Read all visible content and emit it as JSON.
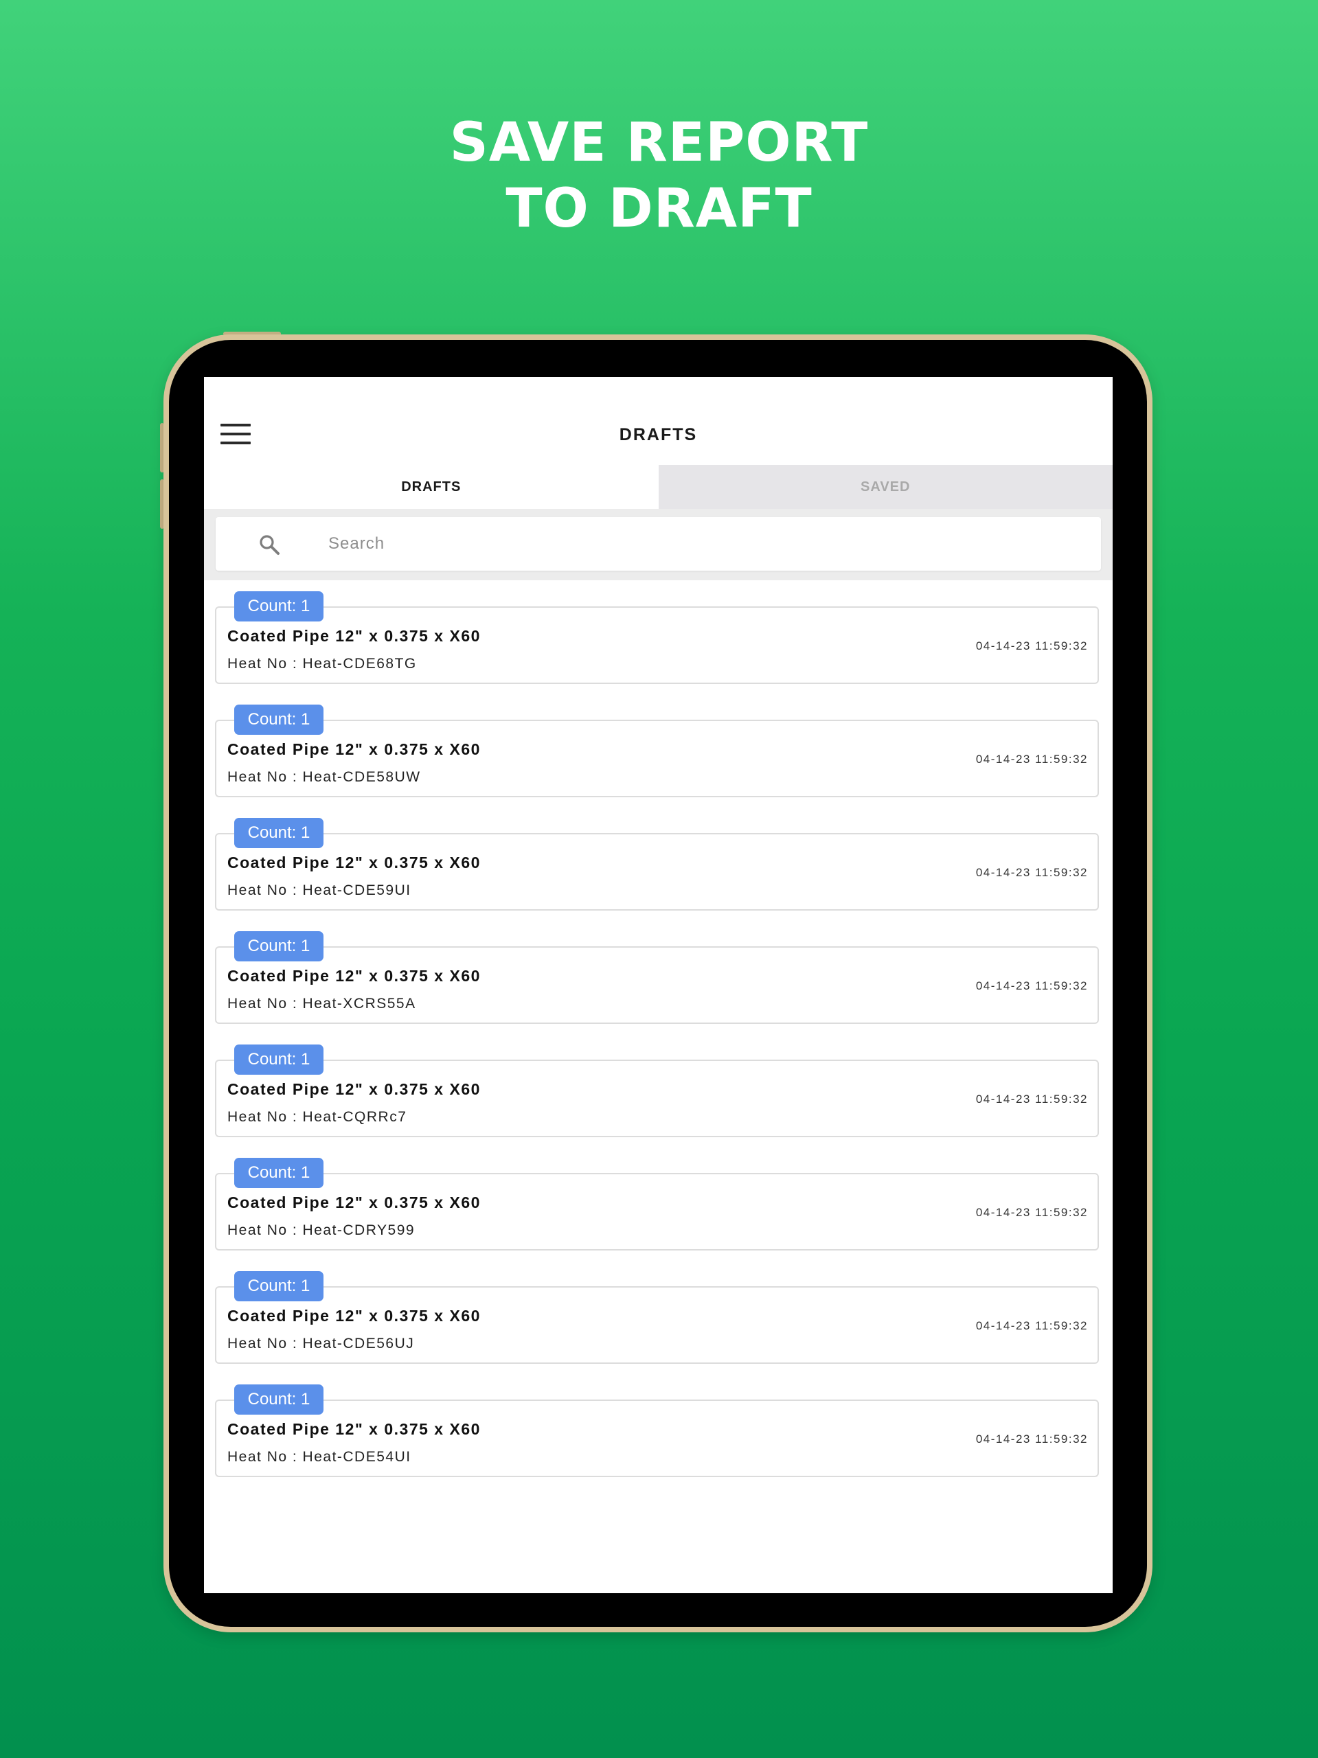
{
  "headline": {
    "line1": "SAVE REPORT",
    "line2": "TO DRAFT"
  },
  "header": {
    "title": "DRAFTS"
  },
  "tabs": [
    {
      "label": "DRAFTS",
      "active": true
    },
    {
      "label": "SAVED",
      "active": false
    }
  ],
  "search": {
    "placeholder": "Search",
    "value": ""
  },
  "icons": {
    "menu": "menu-icon",
    "search": "search-icon"
  },
  "colors": {
    "badge": "#5b90ea",
    "background_top": "#41d27a",
    "background_bottom": "#02904e",
    "inactive_tab": "#e6e5e8"
  },
  "drafts": [
    {
      "badge": "Count: 1",
      "title": "Coated Pipe 12\" x 0.375 x X60",
      "heat": "Heat No : Heat-CDE68TG",
      "time": "04-14-23 11:59:32"
    },
    {
      "badge": "Count: 1",
      "title": "Coated Pipe 12\" x 0.375 x X60",
      "heat": "Heat No : Heat-CDE58UW",
      "time": "04-14-23 11:59:32"
    },
    {
      "badge": "Count: 1",
      "title": "Coated Pipe 12\" x 0.375 x X60",
      "heat": "Heat No : Heat-CDE59UI",
      "time": "04-14-23 11:59:32"
    },
    {
      "badge": "Count: 1",
      "title": "Coated Pipe 12\" x 0.375 x X60",
      "heat": "Heat No : Heat-XCRS55A",
      "time": "04-14-23 11:59:32"
    },
    {
      "badge": "Count: 1",
      "title": "Coated Pipe 12\" x 0.375 x X60",
      "heat": "Heat No : Heat-CQRRc7",
      "time": "04-14-23 11:59:32"
    },
    {
      "badge": "Count: 1",
      "title": "Coated Pipe 12\" x 0.375 x X60",
      "heat": "Heat No : Heat-CDRY599",
      "time": "04-14-23 11:59:32"
    },
    {
      "badge": "Count: 1",
      "title": "Coated Pipe 12\" x 0.375 x X60",
      "heat": "Heat No : Heat-CDE56UJ",
      "time": "04-14-23 11:59:32"
    },
    {
      "badge": "Count: 1",
      "title": "Coated Pipe 12\" x 0.375 x X60",
      "heat": "Heat No : Heat-CDE54UI",
      "time": "04-14-23 11:59:32"
    }
  ]
}
